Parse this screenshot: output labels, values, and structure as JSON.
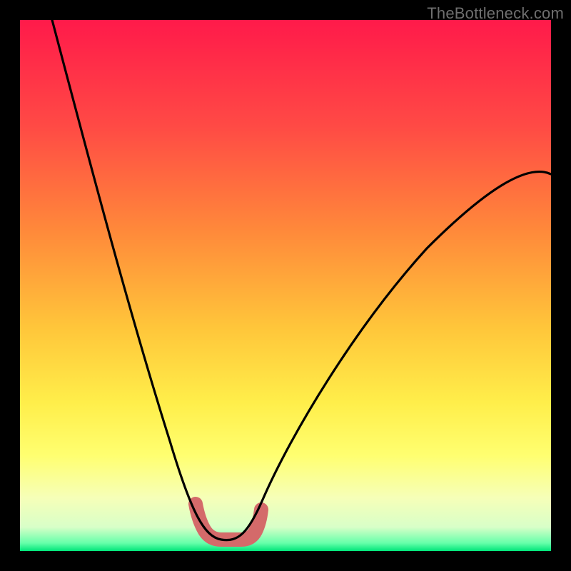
{
  "watermark": "TheBottleneck.com",
  "colors": {
    "frame": "#000000",
    "gradient_top": "#ff1a4a",
    "gradient_mid1": "#ff6a3a",
    "gradient_mid2": "#ffd23a",
    "gradient_mid3": "#ffff66",
    "gradient_mid4": "#f4ffb0",
    "gradient_bottom": "#00ff88",
    "curve": "#000000",
    "marker": "#d46a6a"
  },
  "chart_data": {
    "type": "line",
    "title": "",
    "xlabel": "",
    "ylabel": "",
    "xlim": [
      0,
      100
    ],
    "ylim": [
      0,
      100
    ],
    "series": [
      {
        "name": "bottleneck-curve",
        "x": [
          6,
          8,
          10,
          12,
          14,
          16,
          18,
          20,
          22,
          24,
          26,
          28,
          30,
          32,
          34,
          35,
          36,
          37,
          38,
          39,
          40,
          42,
          44,
          46,
          50,
          55,
          60,
          65,
          70,
          75,
          80,
          85,
          90,
          95,
          100
        ],
        "y": [
          100,
          93,
          86,
          79,
          72,
          65,
          58,
          51,
          44,
          37,
          30,
          24,
          18,
          13,
          8,
          6,
          4,
          2.5,
          2,
          2,
          2,
          3,
          6,
          10,
          17,
          26,
          34,
          41,
          47,
          52,
          57,
          61,
          65,
          68,
          71
        ]
      }
    ],
    "annotations": [
      {
        "name": "optimal-region-marker",
        "shape": "u",
        "x_range": [
          33,
          44
        ],
        "y_range": [
          2,
          9
        ]
      }
    ],
    "gradient_meaning": "vertical color gradient encodes bottleneck severity: red (top) = high bottleneck, green (bottom) = no bottleneck"
  }
}
